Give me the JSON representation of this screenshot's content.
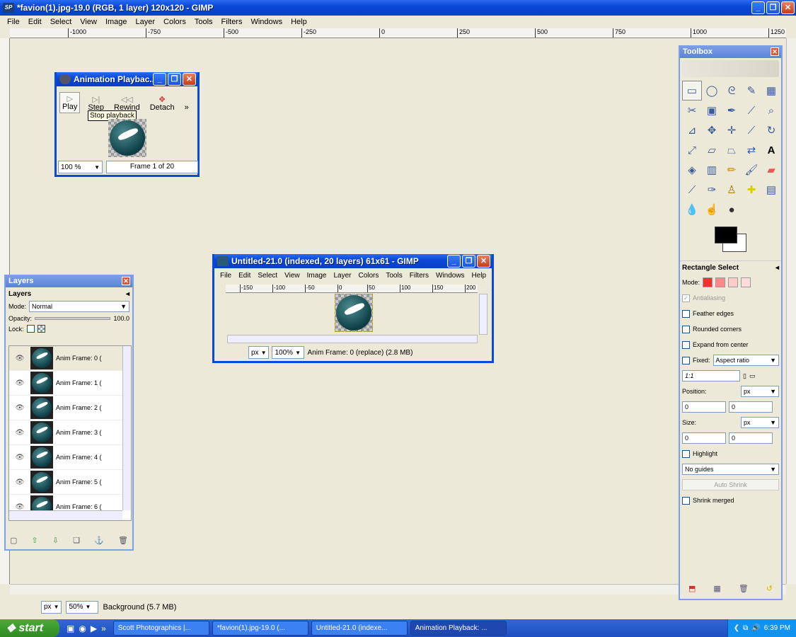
{
  "main": {
    "title": "*favion(1).jpg-19.0 (RGB, 1 layer) 120x120 - GIMP",
    "menu": [
      "File",
      "Edit",
      "Select",
      "View",
      "Image",
      "Layer",
      "Colors",
      "Tools",
      "Filters",
      "Windows",
      "Help"
    ],
    "ruler": [
      "-1000",
      "-750",
      "-500",
      "-250",
      "0",
      "250",
      "500",
      "750",
      "1000",
      "1250"
    ],
    "status": {
      "unit": "px",
      "zoom": "50%",
      "info": "Background (5.7 MB)"
    }
  },
  "anim": {
    "title": "Animation Playbac...",
    "buttons": {
      "play": "Play",
      "step": "Step",
      "rewind": "Rewind",
      "detach": "Detach"
    },
    "tooltip": "Stop playback",
    "zoom": "100 %",
    "frame": "Frame 1 of 20"
  },
  "layers": {
    "panel_title": "Layers",
    "section": "Layers",
    "mode_label": "Mode:",
    "mode_value": "Normal",
    "opacity_label": "Opacity:",
    "opacity_value": "100.0",
    "lock_label": "Lock:",
    "items": [
      "Anim Frame: 0 (",
      "Anim Frame: 1 (",
      "Anim Frame: 2 (",
      "Anim Frame: 3 (",
      "Anim Frame: 4 (",
      "Anim Frame: 5 (",
      "Anim Frame: 6 ("
    ]
  },
  "untitled": {
    "title": "Untitled-21.0 (indexed, 20 layers) 61x61 - GIMP",
    "menu": [
      "File",
      "Edit",
      "Select",
      "View",
      "Image",
      "Layer",
      "Colors",
      "Tools",
      "Filters",
      "Windows",
      "Help"
    ],
    "ruler": [
      "-150",
      "-100",
      "-50",
      "0",
      "50",
      "100",
      "150",
      "200"
    ],
    "unit": "px",
    "zoom": "100%",
    "status": "Anim Frame: 0 (replace) (2.8 MB)"
  },
  "toolbox": {
    "title": "Toolbox",
    "tool_options_title": "Rectangle Select",
    "mode_label": "Mode:",
    "antialiasing": "Antialiasing",
    "feather": "Feather edges",
    "rounded": "Rounded corners",
    "expand": "Expand from center",
    "fixed": "Fixed:",
    "fixed_value": "Aspect ratio",
    "ratio": "1:1",
    "position_label": "Position:",
    "size_label": "Size:",
    "unit": "px",
    "pos_x": "0",
    "pos_y": "0",
    "size_x": "0",
    "size_y": "0",
    "highlight": "Highlight",
    "guides": "No guides",
    "auto_shrink": "Auto Shrink",
    "shrink_merged": "Shrink merged"
  },
  "taskbar": {
    "start": "start",
    "tasks": [
      "Scott Photographics |...",
      "*favion(1).jpg-19.0 (...",
      "Untitled-21.0 (indexe...",
      "Animation Playback: ..."
    ],
    "clock": "6:39 PM"
  }
}
